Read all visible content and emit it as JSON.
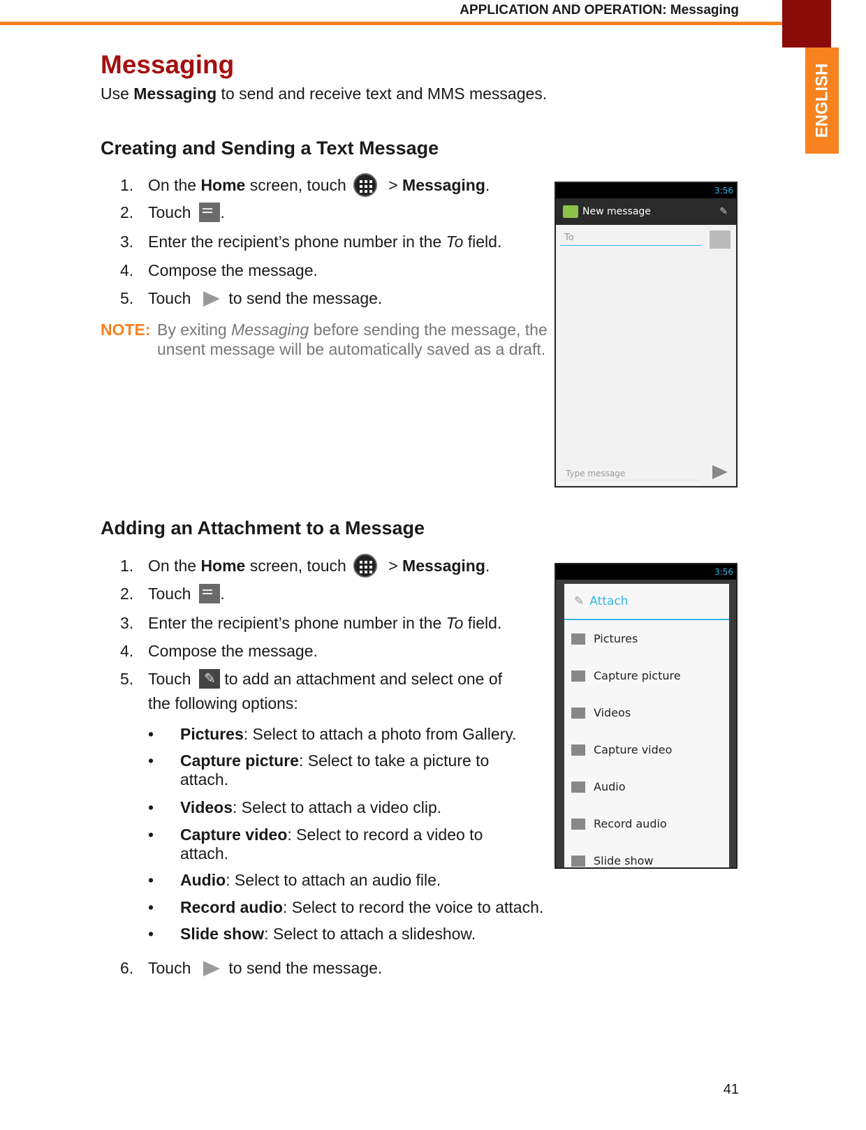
{
  "header": {
    "running_title": "APPLICATION AND OPERATION: Messaging",
    "language_tab": "ENGLISH",
    "accent": "#f7821f",
    "title_color": "#a3100f"
  },
  "title": "Messaging",
  "intro": {
    "pre": "Use ",
    "bold": "Messaging",
    "post": " to send and receive text and MMS messages."
  },
  "section1": {
    "heading": "Creating and Sending a Text Message",
    "steps": [
      {
        "num": "1.",
        "pre": "On the ",
        "b1": "Home",
        "mid": " screen, touch",
        "gt": " > ",
        "b2": "Messaging",
        "end": "."
      },
      {
        "num": "2.",
        "pre": "Touch",
        "end": "."
      },
      {
        "num": "3.",
        "pre": "Enter the recipient’s phone number in the ",
        "it": "To",
        "end": " field."
      },
      {
        "num": "4.",
        "pre": "Compose the message."
      },
      {
        "num": "5.",
        "pre": "Touch",
        "end": "to send the message."
      }
    ],
    "note": {
      "label": "NOTE:",
      "pre": "By exiting ",
      "it": "Messaging",
      "post": " before sending the message, the unsent message will be automatically saved as a draft."
    },
    "screenshot": {
      "time": "3:56",
      "title": "New message",
      "to_placeholder": "To",
      "type_placeholder": "Type message"
    }
  },
  "section2": {
    "heading": "Adding an Attachment to a Message",
    "steps": [
      {
        "num": "1.",
        "pre": "On the ",
        "b1": "Home",
        "mid": " screen, touch",
        "gt": " > ",
        "b2": "Messaging",
        "end": "."
      },
      {
        "num": "2.",
        "pre": "Touch",
        "end": "."
      },
      {
        "num": "3.",
        "pre": "Enter the recipient’s phone number in the ",
        "it": "To",
        "end": " field."
      },
      {
        "num": "4.",
        "pre": "Compose the message."
      },
      {
        "num": "5.",
        "pre": "Touch",
        "end": "to add an attachment and select one of",
        "cont": "the following options:"
      },
      {
        "num": "6.",
        "pre": "Touch",
        "end": "to send the message."
      }
    ],
    "bullets": [
      {
        "b": "Pictures",
        "t": ": Select to attach a photo from Gallery."
      },
      {
        "b": "Capture picture",
        "t": ": Select to take a picture to attach."
      },
      {
        "b": "Videos",
        "t": ": Select to attach a video clip."
      },
      {
        "b": "Capture video",
        "t": ": Select to record a video to attach."
      },
      {
        "b": "Audio",
        "t": ": Select to attach an audio file."
      },
      {
        "b": "Record audio",
        "t": ": Select to record the voice to attach."
      },
      {
        "b": "Slide show",
        "t": ": Select to attach a slideshow."
      }
    ],
    "screenshot": {
      "time": "3:56",
      "title": "Attach",
      "items": [
        "Pictures",
        "Capture picture",
        "Videos",
        "Capture video",
        "Audio",
        "Record audio",
        "Slide show"
      ]
    }
  },
  "page_number": "41"
}
